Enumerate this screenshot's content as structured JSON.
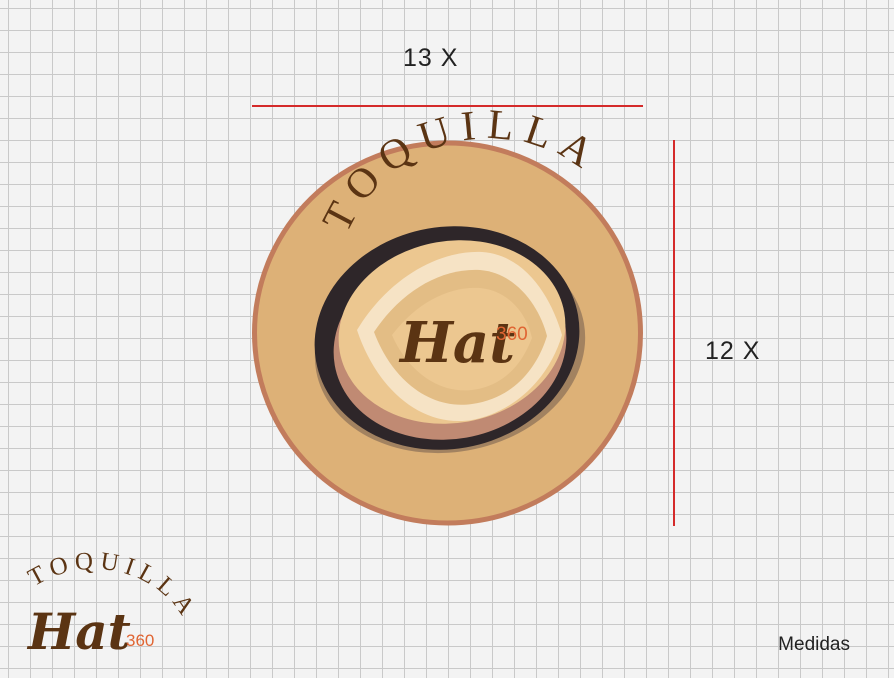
{
  "dimensions": {
    "width_label": "13 X",
    "height_label": "12 X"
  },
  "logo": {
    "arc_text": "TOQUILLA",
    "wordmark": "Hat",
    "number": "360"
  },
  "footer": {
    "label": "Medidas"
  },
  "colors": {
    "grid_line": "#c9c9c9",
    "background": "#f3f3f3",
    "dimension_line": "#d42a2a",
    "logo_ring": "#c27c5c",
    "logo_brim": "#ddb177",
    "logo_band": "#2e2629",
    "logo_crown": "#ecc790",
    "logo_text": "#5b3413",
    "accent_number": "#e06533"
  }
}
